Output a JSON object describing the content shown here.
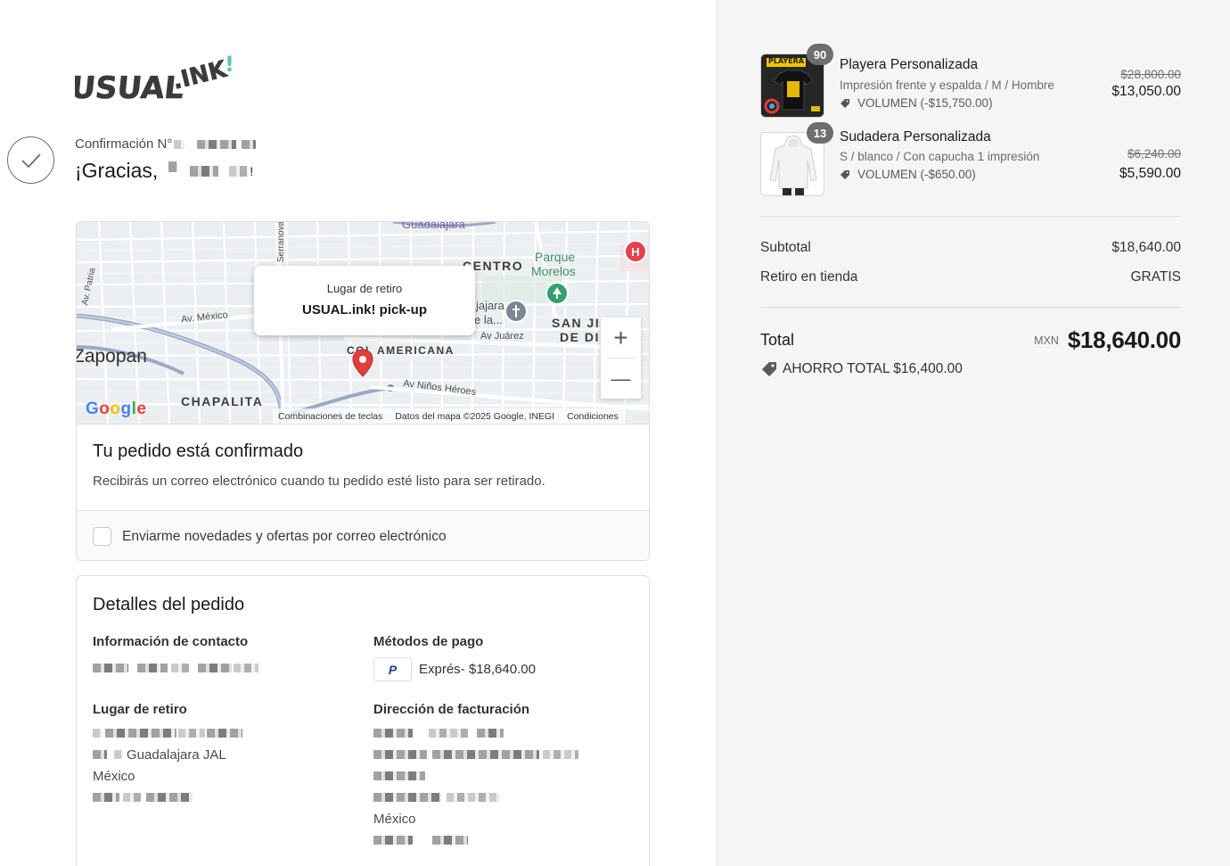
{
  "brand": {
    "logo_text": "USUAL.INK!",
    "accent": "#5bc4b8"
  },
  "header": {
    "confirmation_label": "Confirmación N°",
    "thanks_label": "¡Gracias,",
    "thanks_suffix": "!"
  },
  "map": {
    "labels": {
      "guadalajara": "Guadalajara",
      "serrano": "Serranova",
      "patria": "Av. Patria",
      "centro": "CENTRO",
      "parque": "Parque",
      "morelos": "Morelos",
      "av_mexico": "Av. México",
      "jajara": "jajara",
      "de_la": "e la...",
      "av_juarez": "Av Juárez",
      "san_j": "SAN JI",
      "de_di": "DE DI",
      "zapopan": "Zapopan",
      "americana": "COL AMERICANA",
      "chapalita": "CHAPALITA",
      "ninos_heroes": "Av Niños Héroes"
    },
    "popup_title": "Lugar de retiro",
    "popup_place": "USUAL.ink! pick-up",
    "zoom_in": "+",
    "zoom_out": "—",
    "google": [
      "G",
      "o",
      "o",
      "g",
      "l",
      "e"
    ],
    "hospital_glyph": "H",
    "footer": {
      "shortcuts": "Combinaciones de teclas",
      "map_data": "Datos del mapa ©2025 Google, INEGI",
      "terms": "Condiciones"
    }
  },
  "confirmation": {
    "title": "Tu pedido está confirmado",
    "message": "Recibirás un correo electrónico cuando tu pedido esté listo para ser retirado.",
    "newsletter_label": "Enviarme novedades y ofertas por correo electrónico"
  },
  "details": {
    "title": "Detalles del pedido",
    "contact_heading": "Información de contacto",
    "payment_heading": "Métodos de pago",
    "payment_method": "Exprés",
    "payment_amount": " - $18,640.00",
    "payment_icon_glyph": "P",
    "pickup_heading": "Lugar de retiro",
    "pickup_city": "Guadalajara JAL",
    "pickup_country": "México",
    "billing_heading": "Dirección de facturación",
    "billing_country": "México"
  },
  "items": [
    {
      "name": "Playera Personalizada",
      "variant": "Impresión frente y espalda / M / Hombre",
      "discount": "VOLUMEN (-$15,750.00)",
      "original_price": "$28,800.00",
      "price": "$13,050.00",
      "quantity": "90",
      "thumb_label": "PLAYERA"
    },
    {
      "name": "Sudadera Personalizada",
      "variant": "S / blanco / Con capucha 1 impresión",
      "discount": "VOLUMEN (-$650.00)",
      "original_price": "$6,240.00",
      "price": "$5,590.00",
      "quantity": "13"
    }
  ],
  "summary": {
    "subtotal_label": "Subtotal",
    "subtotal_value": "$18,640.00",
    "shipping_label": "Retiro en tienda",
    "shipping_value": "GRATIS",
    "total_label": "Total",
    "currency": "MXN",
    "total_value": "$18,640.00",
    "savings": "AHORRO TOTAL $16,400.00"
  }
}
